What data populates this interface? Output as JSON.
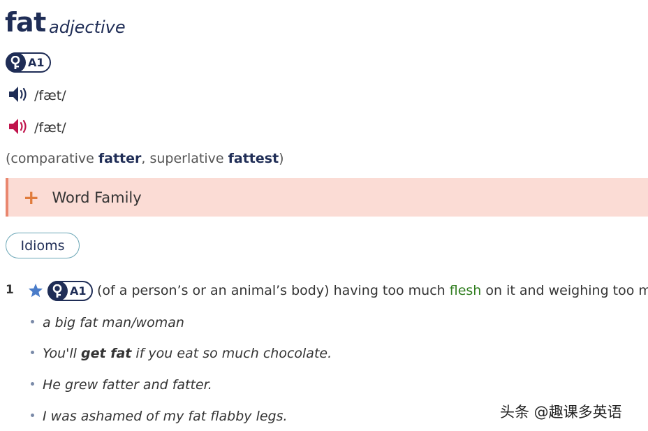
{
  "entry": {
    "headword": "fat",
    "part_of_speech": "adjective",
    "level": "A1",
    "pronunciations": [
      {
        "region": "uk",
        "ipa": "/fæt/",
        "icon": "speaker-icon",
        "color": "#1f2d56"
      },
      {
        "region": "us",
        "ipa": "/fæt/",
        "icon": "speaker-icon",
        "color": "#c0144c"
      }
    ],
    "forms": {
      "open_paren": "(",
      "comparative_label": "comparative",
      "comparative": "fatter",
      "separator": ", ",
      "superlative_label": "superlative",
      "superlative": "fattest",
      "close_paren": ")"
    }
  },
  "word_family": {
    "icon": "plus-icon",
    "label": "Word Family",
    "accent": "#e07b3c",
    "background": "#fbdcd5"
  },
  "idioms_button": {
    "label": "Idioms"
  },
  "senses": [
    {
      "number": "1",
      "level": "A1",
      "definition_before": "(of a person’s or an animal’s body) having too much ",
      "definition_link": "flesh",
      "definition_after": " on it and weighing too much",
      "examples": [
        {
          "before": "a big fat man/woman",
          "bold": "",
          "after": ""
        },
        {
          "before": "You'll ",
          "bold": "get fat",
          "after": " if you eat so much chocolate."
        },
        {
          "before": "He grew fatter and fatter.",
          "bold": "",
          "after": ""
        },
        {
          "before": "I was ashamed of my fat flabby legs.",
          "bold": "",
          "after": ""
        }
      ]
    }
  ],
  "watermark": "头条 @趣课多英语",
  "colors": {
    "brand": "#1f2d56",
    "link_green": "#2f7d1e",
    "us_speaker": "#c0144c",
    "star": "#4a7cc9"
  }
}
